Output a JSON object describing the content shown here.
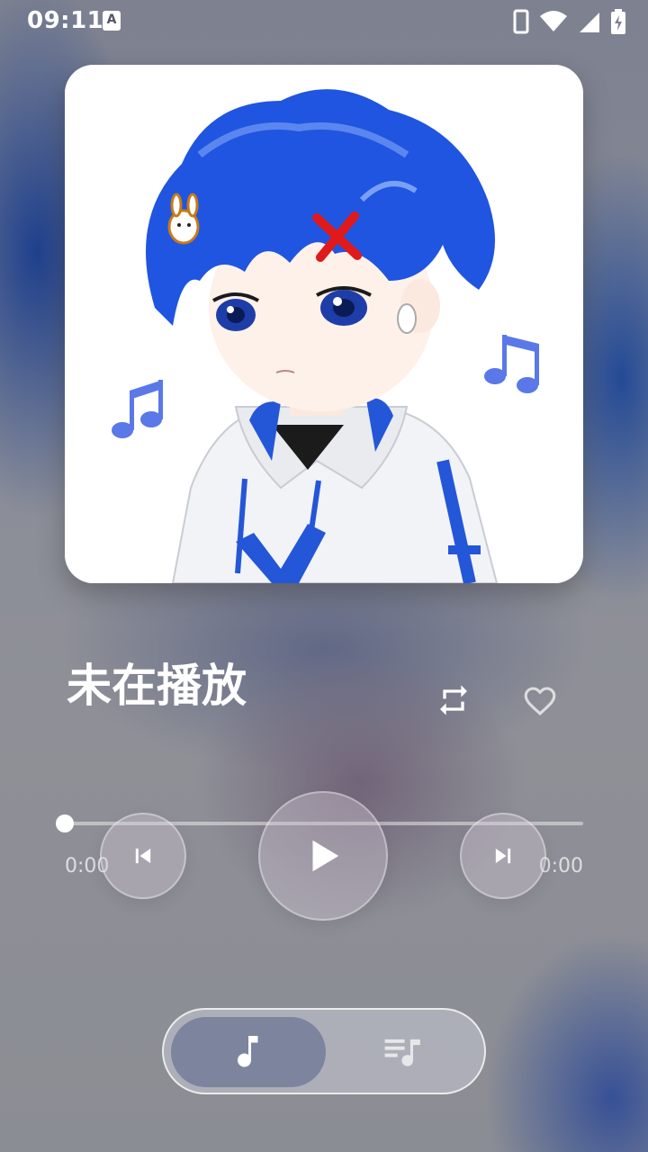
{
  "status_bar": {
    "time": "09:11",
    "notification_icon": "a-letter-icon",
    "icons": [
      "phone-icon",
      "wifi-icon",
      "signal-icon",
      "battery-charging-icon"
    ]
  },
  "album": {
    "art_description_icon": "album-art-image"
  },
  "song": {
    "title": "未在播放"
  },
  "actions": {
    "repeat_icon": "repeat-icon",
    "favorite_icon": "heart-icon"
  },
  "player": {
    "current_time": "0:00",
    "total_time": "0:00",
    "progress": 0
  },
  "controls": {
    "prev_icon": "skip-previous-icon",
    "play_icon": "play-icon",
    "next_icon": "skip-next-icon"
  },
  "bottom_nav": {
    "items": [
      {
        "icon": "music-note-icon",
        "active": true
      },
      {
        "icon": "playlist-icon",
        "active": false
      }
    ]
  },
  "colors": {
    "accent_blue": "#2456d8",
    "note_blue": "#5a78e8"
  }
}
